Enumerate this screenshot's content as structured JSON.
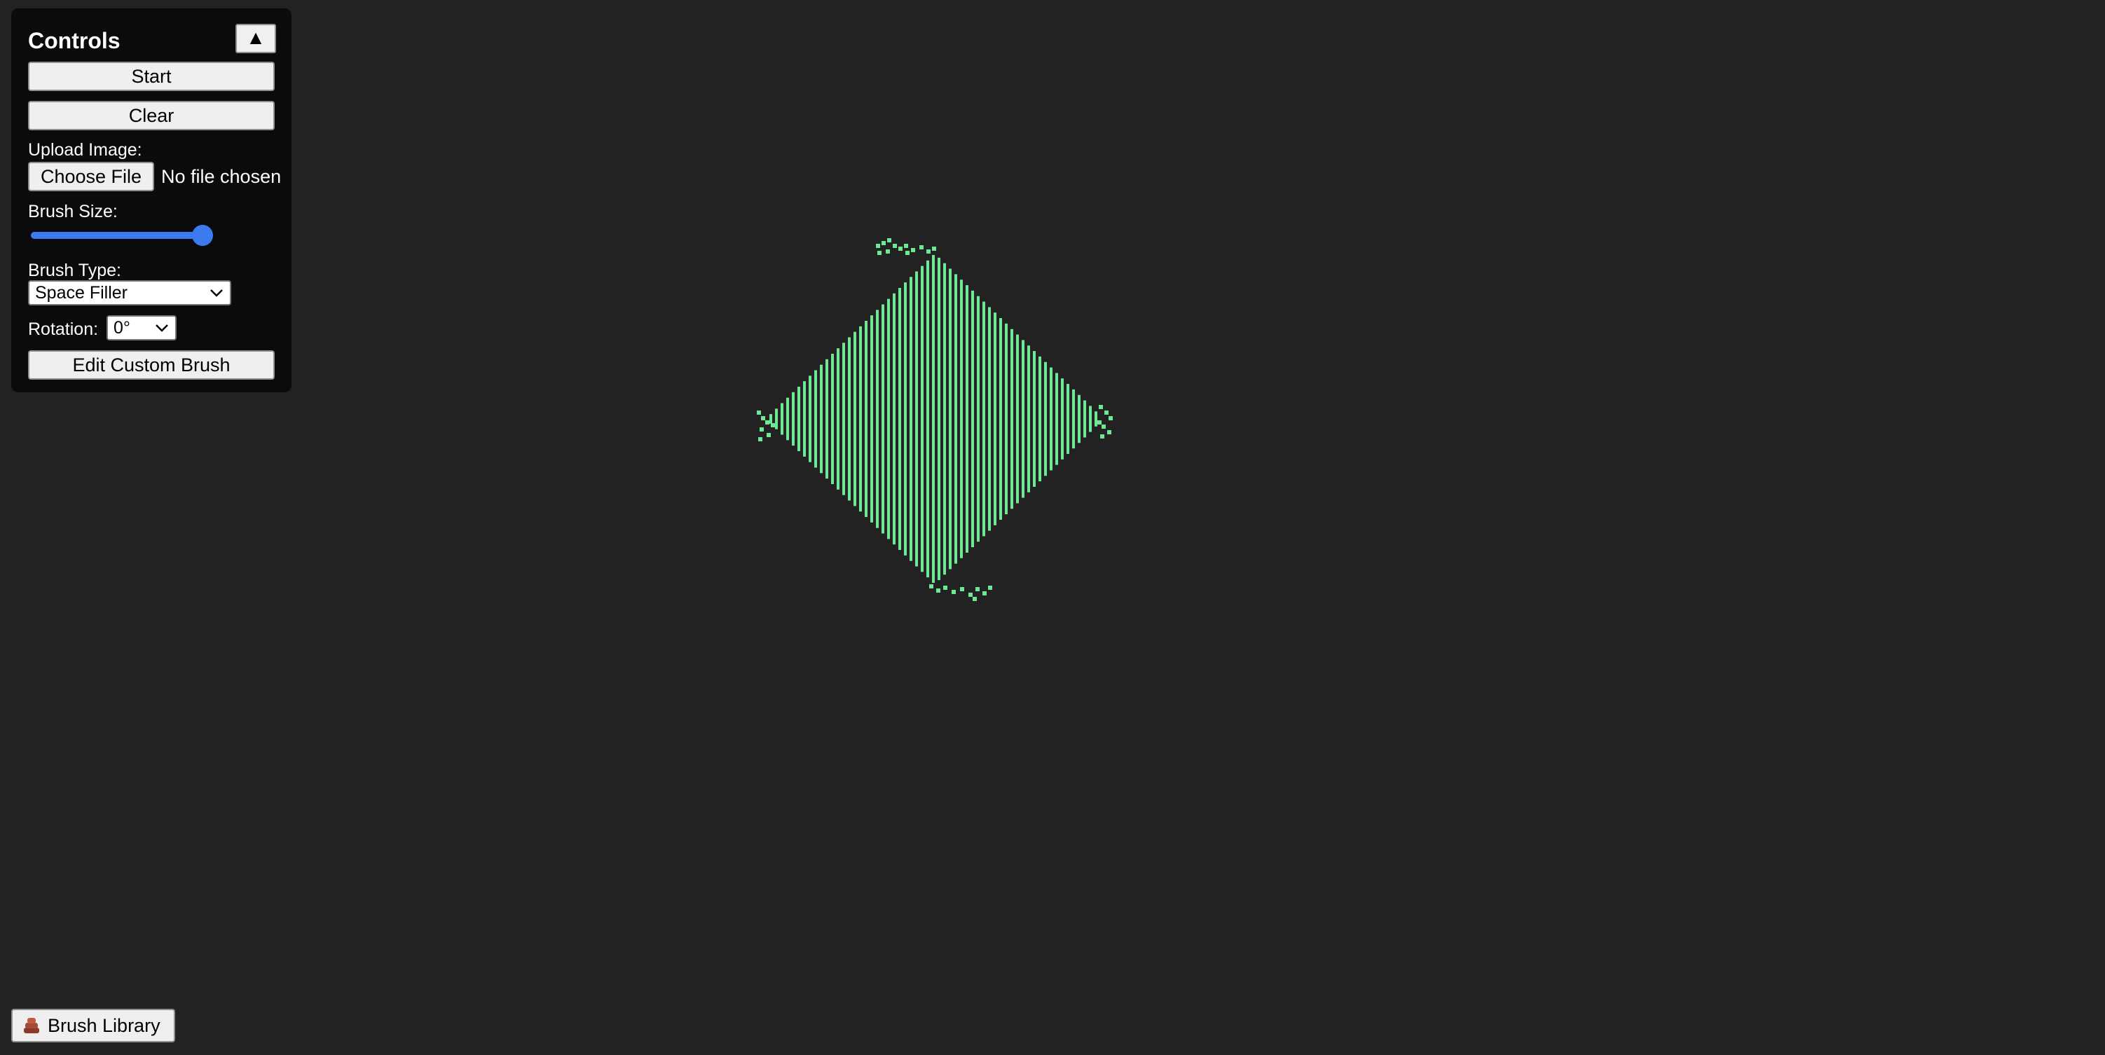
{
  "controls": {
    "title": "Controls",
    "collapse_glyph": "▲",
    "start_label": "Start",
    "clear_label": "Clear",
    "upload_label": "Upload Image:",
    "choose_file_label": "Choose File",
    "file_status": "No file chosen",
    "brush_size_label": "Brush Size:",
    "brush_size_value": 1.0,
    "brush_type_label": "Brush Type:",
    "brush_type_selected": "Space Filler",
    "rotation_label": "Rotation:",
    "rotation_selected": "0°",
    "edit_brush_label": "Edit Custom Brush"
  },
  "library": {
    "label": "Brush Library",
    "icon": "brush-stack-icon"
  },
  "colors": {
    "background": "#222222",
    "panel": "#0b0b0b",
    "cell": "#6ee894",
    "accent": "#3b7bef"
  }
}
